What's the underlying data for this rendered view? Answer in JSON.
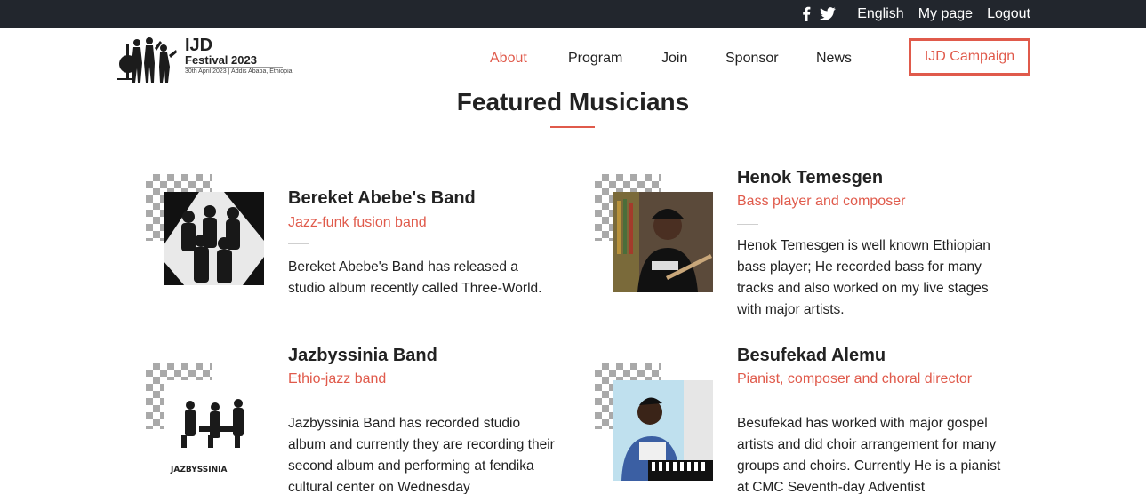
{
  "topbar": {
    "social_icons": [
      "facebook-icon",
      "twitter-icon"
    ],
    "links": [
      "English",
      "My page",
      "Logout"
    ]
  },
  "logo": {
    "title": "IJD",
    "subtitle": "Festival 2023",
    "date": "30th April 2023 | Addis Ababa, Ethiopia"
  },
  "nav": {
    "items": [
      "About",
      "Program",
      "Join",
      "Sponsor",
      "News"
    ],
    "active": "About",
    "campaign": "IJD Campaign"
  },
  "section": {
    "title": "Featured Musicians"
  },
  "musicians": [
    {
      "name": "Bereket Abebe's Band",
      "role": "Jazz-funk fusion band",
      "description": "Bereket Abebe's Band has released a studio album recently called Three-World."
    },
    {
      "name": "Henok Temesgen",
      "role": "Bass player and composer",
      "description": "Henok Temesgen is well known Ethiopian bass player; He recorded bass for many tracks and also worked on my live stages with major artists."
    },
    {
      "name": "Jazbyssinia Band",
      "role": "Ethio-jazz band",
      "description": "Jazbyssinia Band has recorded studio album and currently they are recording their second album and performing at fendika cultural center on Wednesday"
    },
    {
      "name": "Besufekad Alemu",
      "role": "Pianist, composer and choral director",
      "description": "Besufekad has worked with major gospel artists and did choir arrangement for many groups and choirs. Currently He is a pianist at CMC Seventh-day Adventist"
    }
  ],
  "colors": {
    "accent": "#e05a4b",
    "topbar": "#22262d",
    "text": "#222222"
  }
}
